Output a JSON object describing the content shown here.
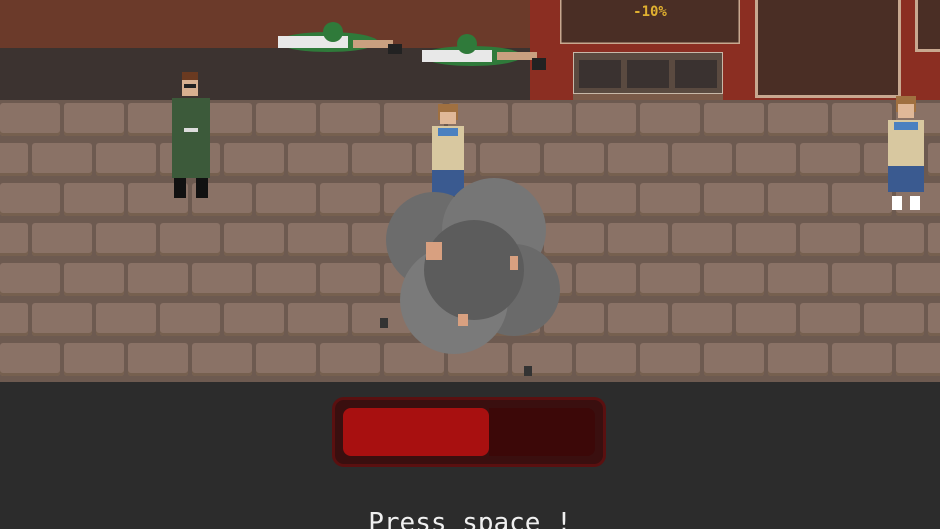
{
  "shop": {
    "price_sign": "-10%"
  },
  "hud": {
    "health_fraction": 0.58,
    "prompt": "Press space !"
  },
  "colors": {
    "health_fill": "#a81010",
    "health_empty": "#3c0808",
    "pavement": "#6d5a50"
  },
  "sprites": [
    "soldier-standing",
    "soldier-lying-1",
    "soldier-lying-2",
    "schoolgirl-1",
    "schoolgirl-2",
    "smoke-cloud"
  ]
}
